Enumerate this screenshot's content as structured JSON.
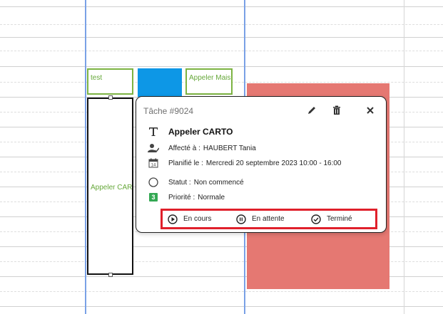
{
  "events": {
    "test_label": "test",
    "appeler_mais_label": "Appeler Mais",
    "selected_label": "Appeler CAR"
  },
  "popup": {
    "title": "Tâche #9024",
    "task_name": "Appeler CARTO",
    "assigned": {
      "label": "Affecté à :",
      "value": "HAUBERT Tania"
    },
    "planned": {
      "label": "Planifié le :",
      "value": "Mercredi 20 septembre 2023 10:00 - 16:00"
    },
    "status": {
      "label": "Statut :",
      "value": "Non commencé"
    },
    "priority": {
      "label": "Priorité :",
      "value": "Normale",
      "badge": "3"
    },
    "actions": {
      "in_progress": "En cours",
      "waiting": "En attente",
      "done": "Terminé"
    }
  },
  "colors": {
    "accent_blue": "#0d97e6",
    "event_red": "#e57872",
    "event_green_border": "#7cb342",
    "highlight_red": "#e0202b",
    "priority_green": "#34a853",
    "column_divider_blue": "#7aa1e6"
  }
}
